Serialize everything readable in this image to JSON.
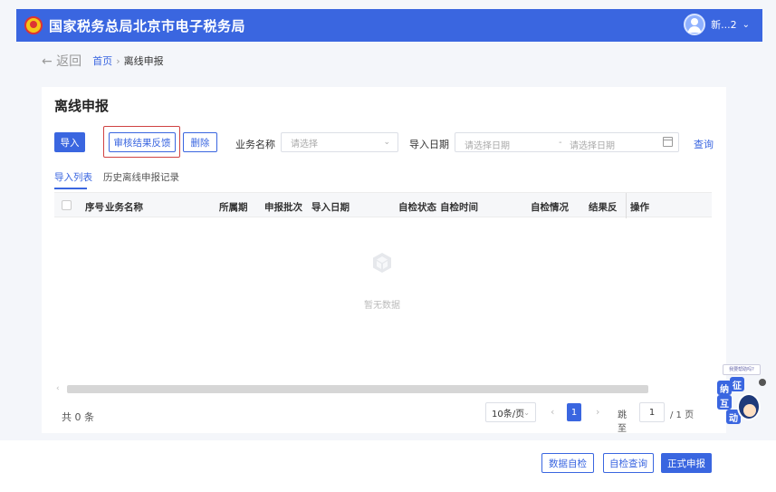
{
  "header": {
    "site_title": "国家税务总局北京市电子税务局",
    "user_name": "新...2",
    "user_chevron": "⌄"
  },
  "breadcrumb": {
    "back_label": "← 返回",
    "home": "首页",
    "separator": "›",
    "current": "离线申报"
  },
  "page": {
    "title": "离线申报"
  },
  "toolbar": {
    "import_label": "导入",
    "feedback_label": "审核结果反馈",
    "delete_label": "删除",
    "business_name_label": "业务名称",
    "business_name_placeholder": "请选择",
    "import_date_label": "导入日期",
    "date_start_placeholder": "请选择日期",
    "date_separator": "-",
    "date_end_placeholder": "请选择日期",
    "query_label": "查询"
  },
  "tabs": [
    {
      "label": "导入列表"
    },
    {
      "label": "历史离线申报记录"
    }
  ],
  "table": {
    "columns": [
      "序号",
      "业务名称",
      "所属期",
      "申报批次",
      "导入日期",
      "自检状态",
      "自检时间",
      "自检情况",
      "结果反",
      "操作"
    ],
    "rows": [],
    "empty_text": "暂无数据"
  },
  "pagination": {
    "total": "共 0 条",
    "page_size": "10条/页",
    "current_page": "1",
    "goto_label": "跳至",
    "goto_value": "1",
    "page_total": "/ 1 页"
  },
  "footer": {
    "self_check_label": "数据自检",
    "check_query_label": "自检查询",
    "submit_label": "正式申报"
  },
  "assistant": {
    "tip": "我要帮助吗?",
    "chars": [
      "纳",
      "征",
      "互",
      "动"
    ]
  },
  "colors": {
    "brand": "#3a66e0",
    "highlight": "#d04242"
  }
}
